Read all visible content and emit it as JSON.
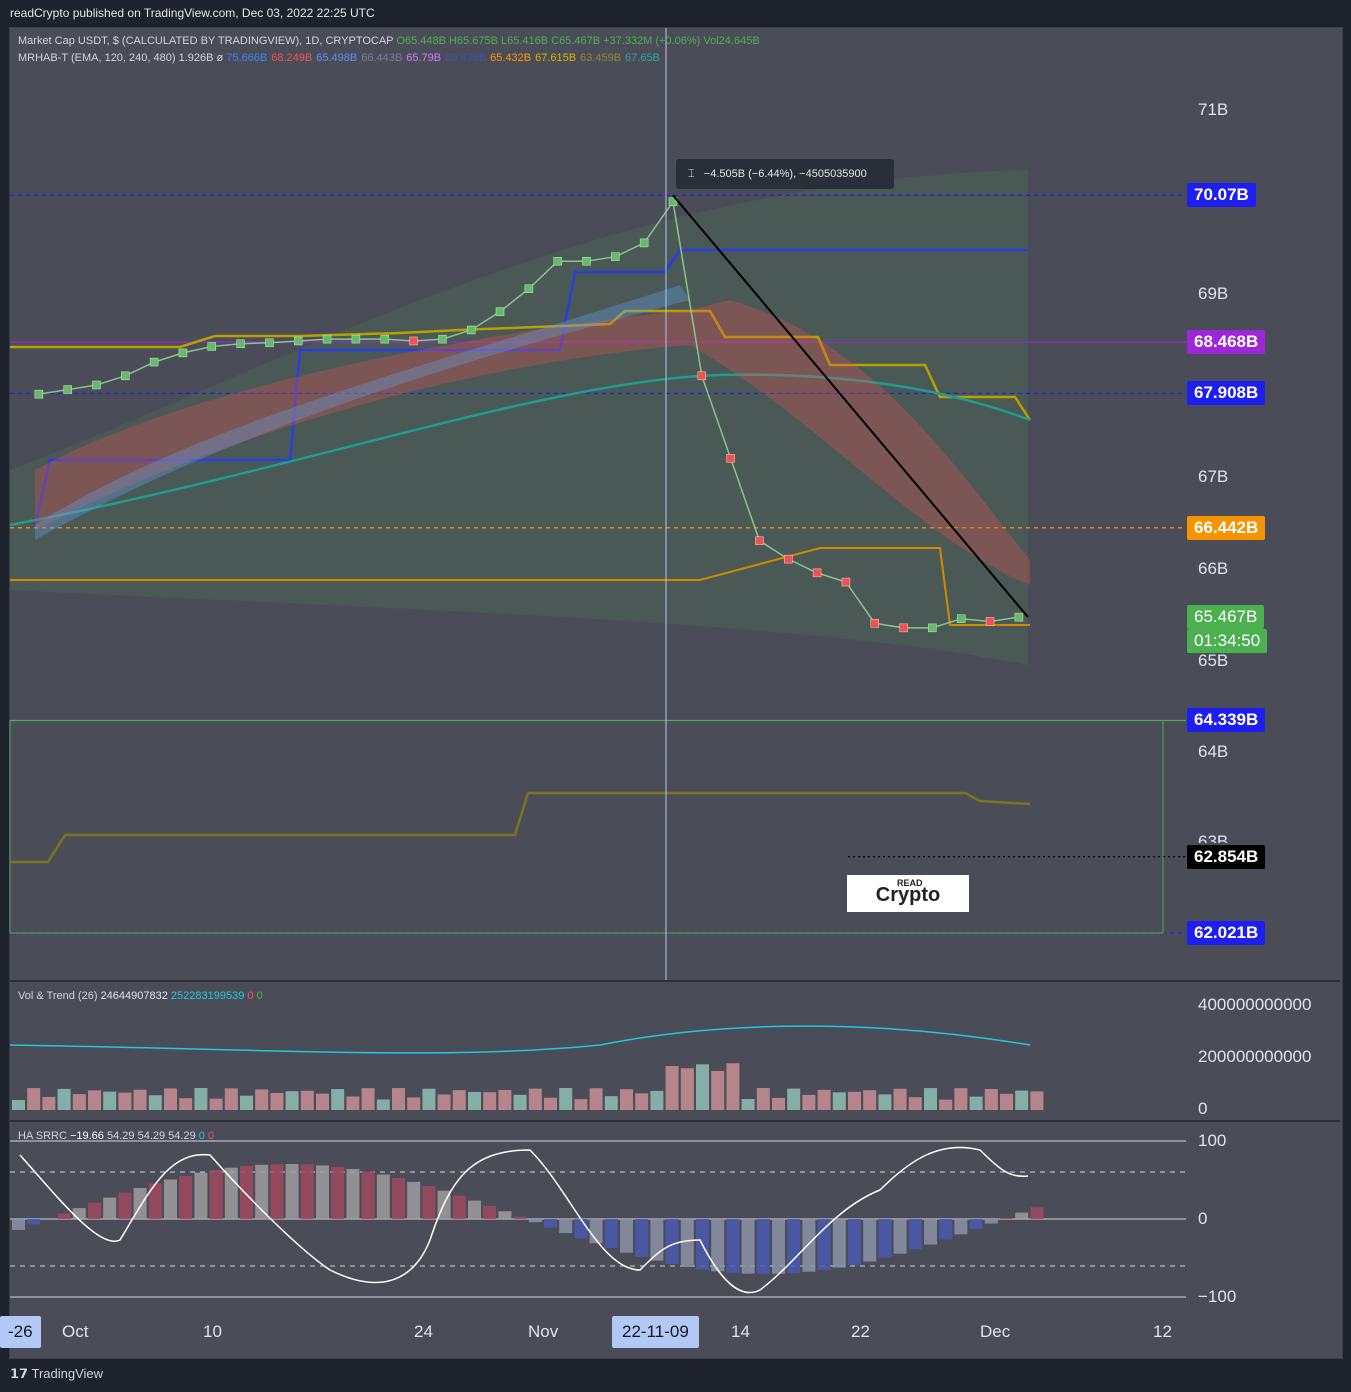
{
  "header": {
    "publisher": "readCrypto published on TradingView.com, Dec 03, 2022 22:25 UTC"
  },
  "legend": {
    "line1": "Market Cap USDT, $ (CALCULATED BY TRADINGVIEW), 1D, CRYPTOCAP",
    "ohlc": "O65.448B  H65.675B  L65.416B  C65.467B  +37.332M (+0.06%)  Vol24.645B",
    "line2_label": "MRHAB-T (EMA, 120, 240, 480)  1.926B  ø",
    "line2_values": [
      "75.666B",
      "68.249B",
      "65.498B",
      "66.443B",
      "65.79B",
      "69.476B",
      "65.432B",
      "67.615B",
      "63.459B",
      "67.65B"
    ],
    "line2_colors": [
      "#3b82f6",
      "#ef5350",
      "#5b8def",
      "#7b7b9a",
      "#c77dff",
      "#3f51b5",
      "#ff9800",
      "#d4b800",
      "#8a8a30",
      "#26a69a"
    ],
    "vol_label": "Vol & Trend (26)",
    "vol_val1": "24644907832",
    "vol_val2": "252283199539",
    "vol_val3": "0",
    "vol_val4": "0",
    "ha_label": "HA SRRC",
    "ha_v1": "−19.66",
    "ha_v2": "54.29",
    "ha_v3": "54.29",
    "ha_v4": "54.29",
    "ha_v5": "0",
    "ha_v6": "0"
  },
  "tooltip": {
    "text": "−4.505B (−6.44%), −4505035900"
  },
  "price_tags": [
    {
      "label": "70.07B",
      "bg": "#1e1ef0"
    },
    {
      "label": "68.468B",
      "bg": "#9c27d8"
    },
    {
      "label": "67.908B",
      "bg": "#1e1ef0"
    },
    {
      "label": "66.442B",
      "bg": "#f59300"
    },
    {
      "label": "65.467B",
      "bg": "#4caf50"
    },
    {
      "label": "01:34:50",
      "bg": "#4caf50"
    },
    {
      "label": "64.339B",
      "bg": "#1e1ef0"
    },
    {
      "label": "62.854B",
      "bg": "#000000"
    },
    {
      "label": "62.021B",
      "bg": "#1e1ef0"
    }
  ],
  "y_axis": [
    "71B",
    "69B",
    "67B",
    "66B",
    "65B",
    "64B",
    "63B"
  ],
  "vol_axis": [
    "400000000000",
    "200000000000",
    "0"
  ],
  "osc_axis": [
    "100",
    "0",
    "−100"
  ],
  "x_axis": [
    "-26",
    "Oct",
    "10",
    "24",
    "Nov",
    "14",
    "22",
    "Dec",
    "12"
  ],
  "x_highlight": "22-11-09",
  "logo": {
    "read": "READ",
    "crypto": "Crypto"
  },
  "footer": {
    "brand": "TradingView"
  },
  "chart_data": {
    "type": "line",
    "title": "Market Cap USDT, $ (CALCULATED BY TRADINGVIEW), 1D, CRYPTOCAP",
    "xlabel": "",
    "ylabel": "",
    "ylim": [
      61.9,
      71.9
    ],
    "x": [
      "2022-09-26",
      "2022-09-28",
      "2022-09-30",
      "2022-10-02",
      "2022-10-04",
      "2022-10-06",
      "2022-10-08",
      "2022-10-10",
      "2022-10-12",
      "2022-10-14",
      "2022-10-16",
      "2022-10-18",
      "2022-10-20",
      "2022-10-22",
      "2022-10-24",
      "2022-10-26",
      "2022-10-28",
      "2022-10-30",
      "2022-11-01",
      "2022-11-03",
      "2022-11-05",
      "2022-11-07",
      "2022-11-09",
      "2022-11-11",
      "2022-11-13",
      "2022-11-15",
      "2022-11-17",
      "2022-11-19",
      "2022-11-21",
      "2022-11-23",
      "2022-11-25",
      "2022-11-27",
      "2022-11-29",
      "2022-12-01",
      "2022-12-03"
    ],
    "series": [
      {
        "values": [
          67.9,
          67.95,
          68.0,
          68.1,
          68.25,
          68.35,
          68.42,
          68.45,
          68.46,
          68.48,
          68.5,
          68.5,
          68.5,
          68.48,
          68.5,
          68.6,
          68.8,
          69.05,
          69.35,
          69.35,
          69.4,
          69.55,
          70.0,
          68.1,
          67.2,
          66.3,
          66.1,
          65.95,
          65.85,
          65.4,
          65.35,
          65.35,
          65.45,
          65.42,
          65.467
        ]
      }
    ],
    "horizontal_levels": [
      {
        "label": "70.07B",
        "value": 70.07,
        "style": "dashed"
      },
      {
        "label": "68.468B",
        "value": 68.468,
        "style": "solid"
      },
      {
        "label": "67.908B",
        "value": 67.908,
        "style": "dashed"
      },
      {
        "label": "66.442B",
        "value": 66.442,
        "style": "dashed"
      },
      {
        "label": "64.339B",
        "value": 64.339,
        "style": "solid"
      },
      {
        "label": "62.854B",
        "value": 62.854,
        "style": "dotted"
      },
      {
        "label": "62.021B",
        "value": 62.021,
        "style": "dashed"
      }
    ],
    "measure": {
      "from_value": 70.07,
      "to_value": 65.467,
      "change": "−4.505B (−6.44%)"
    },
    "last_price": 65.467
  }
}
